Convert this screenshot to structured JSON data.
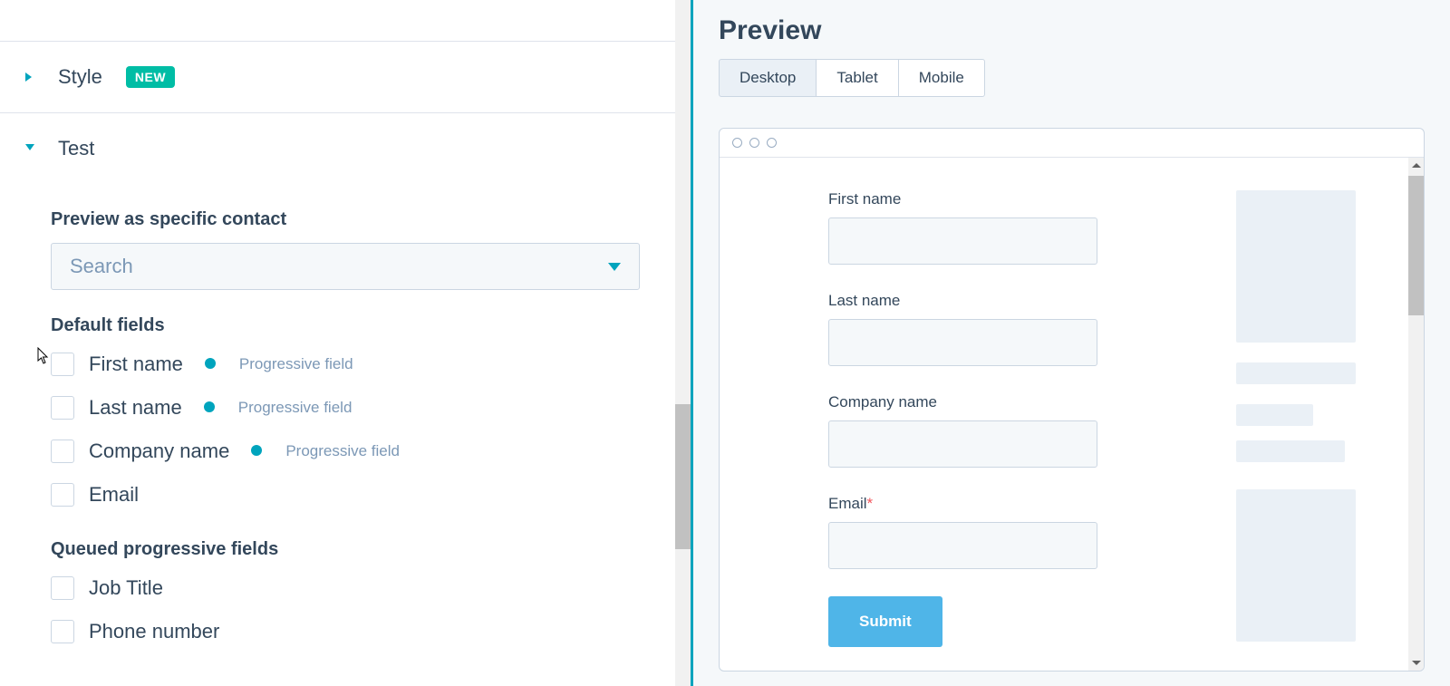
{
  "left": {
    "style": {
      "label": "Style",
      "badge": "NEW"
    },
    "test": {
      "label": "Test",
      "previewAsContact": "Preview as specific contact",
      "searchPlaceholder": "Search",
      "defaultFieldsHeading": "Default fields",
      "defaultFields": [
        {
          "label": "First name",
          "progressive": true,
          "progText": "Progressive field"
        },
        {
          "label": "Last name",
          "progressive": true,
          "progText": "Progressive field"
        },
        {
          "label": "Company name",
          "progressive": true,
          "progText": "Progressive field"
        },
        {
          "label": "Email",
          "progressive": false
        }
      ],
      "queuedHeading": "Queued progressive fields",
      "queuedFields": [
        {
          "label": "Job Title"
        },
        {
          "label": "Phone number"
        }
      ]
    }
  },
  "right": {
    "title": "Preview",
    "tabs": {
      "desktop": "Desktop",
      "tablet": "Tablet",
      "mobile": "Mobile"
    },
    "form": {
      "firstName": "First name",
      "lastName": "Last name",
      "companyName": "Company name",
      "email": "Email",
      "submit": "Submit"
    }
  }
}
